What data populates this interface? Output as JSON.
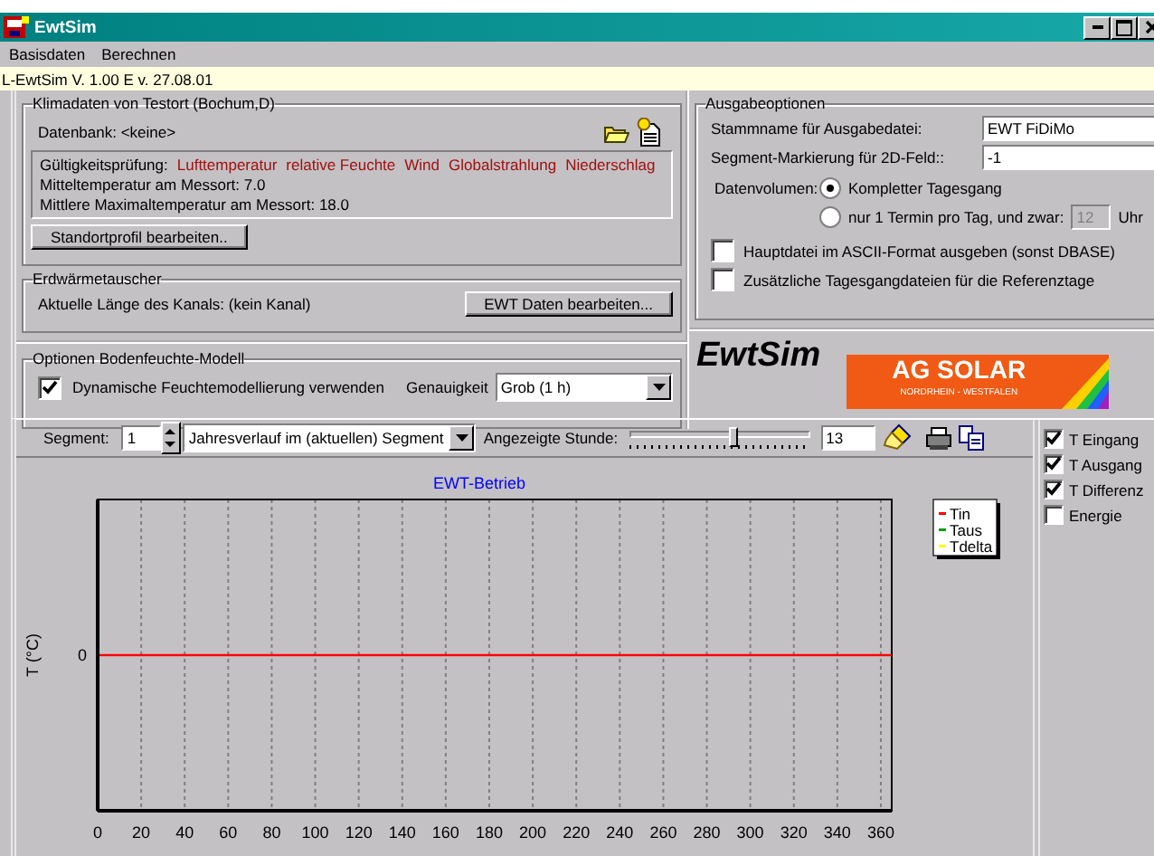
{
  "window": {
    "title": "EwtSim"
  },
  "menu": [
    "Basisdaten",
    "Berechnen"
  ],
  "version": "L-EwtSim V. 1.00 E  v. 27.08.01",
  "climate": {
    "title": "Klimadaten von Testort (Bochum,D)",
    "database": "Datenbank: <keine>",
    "validity_label": "Gültigkeitsprüfung:",
    "validity_items": [
      "Lufttemperatur",
      "relative Feuchte",
      "Wind",
      "Globalstrahlung",
      "Niederschlag"
    ],
    "mean_temp": "Mitteltemperatur am Messort: 7.0",
    "max_temp": "Mittlere Maximaltemperatur am Messort: 18.0",
    "button": "Standortprofil bearbeiten.."
  },
  "heat_exchanger": {
    "title": "Erdwärmetauscher",
    "length": "Aktuelle Länge des Kanals: (kein Kanal)",
    "button": "EWT Daten bearbeiten..."
  },
  "moisture": {
    "title": "Optionen Bodenfeuchte-Modell",
    "dynamic": {
      "label": "Dynamische Feuchtemodellierung verwenden",
      "checked": true
    },
    "accuracy_label": "Genauigkeit",
    "accuracy_value": "Grob (1 h)"
  },
  "output": {
    "title": "Ausgabeoptionen",
    "stem_label": "Stammname für Ausgabedatei:",
    "stem_value": "EWT FiDiMo",
    "segment_label": "Segment-Markierung für 2D-Feld::",
    "segment_value": "-1",
    "volume_label": "Datenvolumen:",
    "volume_options": [
      {
        "label": "Kompletter Tagesgang",
        "selected": true
      },
      {
        "label": "nur 1 Termin pro Tag, und zwar:",
        "selected": false
      }
    ],
    "hour_field": {
      "value": "12",
      "disabled": true
    },
    "hour_unit": "Uhr",
    "checks": [
      {
        "label": "Hauptdatei im ASCII-Format ausgeben (sonst DBASE)",
        "checked": false
      },
      {
        "label": "Zusätzliche Tagesgangdateien für die Referenztage",
        "checked": false
      }
    ]
  },
  "branding": {
    "app_name": "EwtSim",
    "logo_title": "AG SOLAR",
    "logo_subtitle": "NORDRHEIN - WESTFALEN"
  },
  "toolbar": {
    "segment_label": "Segment:",
    "segment_value": "1",
    "view_value": "Jahresverlauf im (aktuellen) Segment",
    "hour_label": "Angezeigte Stunde:",
    "hour_slider": {
      "level": 0.57
    },
    "hour_value": "13"
  },
  "chart": {
    "title": "EWT-Betrieb",
    "ylabel": "T (°C)",
    "y_tick": "0",
    "x_ticks": [
      "0",
      "20",
      "40",
      "60",
      "80",
      "100",
      "120",
      "140",
      "160",
      "180",
      "200",
      "220",
      "240",
      "260",
      "280",
      "300",
      "320",
      "340",
      "360"
    ],
    "legend": [
      {
        "name": "Tin",
        "color": "#ff0000"
      },
      {
        "name": "Taus",
        "color": "#00a000"
      },
      {
        "name": "Tdelta",
        "color": "#ffff00"
      }
    ]
  },
  "series_checks": [
    {
      "label": "T Eingang",
      "checked": true
    },
    {
      "label": "T Ausgang",
      "checked": true
    },
    {
      "label": "T Differenz",
      "checked": true
    },
    {
      "label": "Energie",
      "checked": false
    }
  ]
}
